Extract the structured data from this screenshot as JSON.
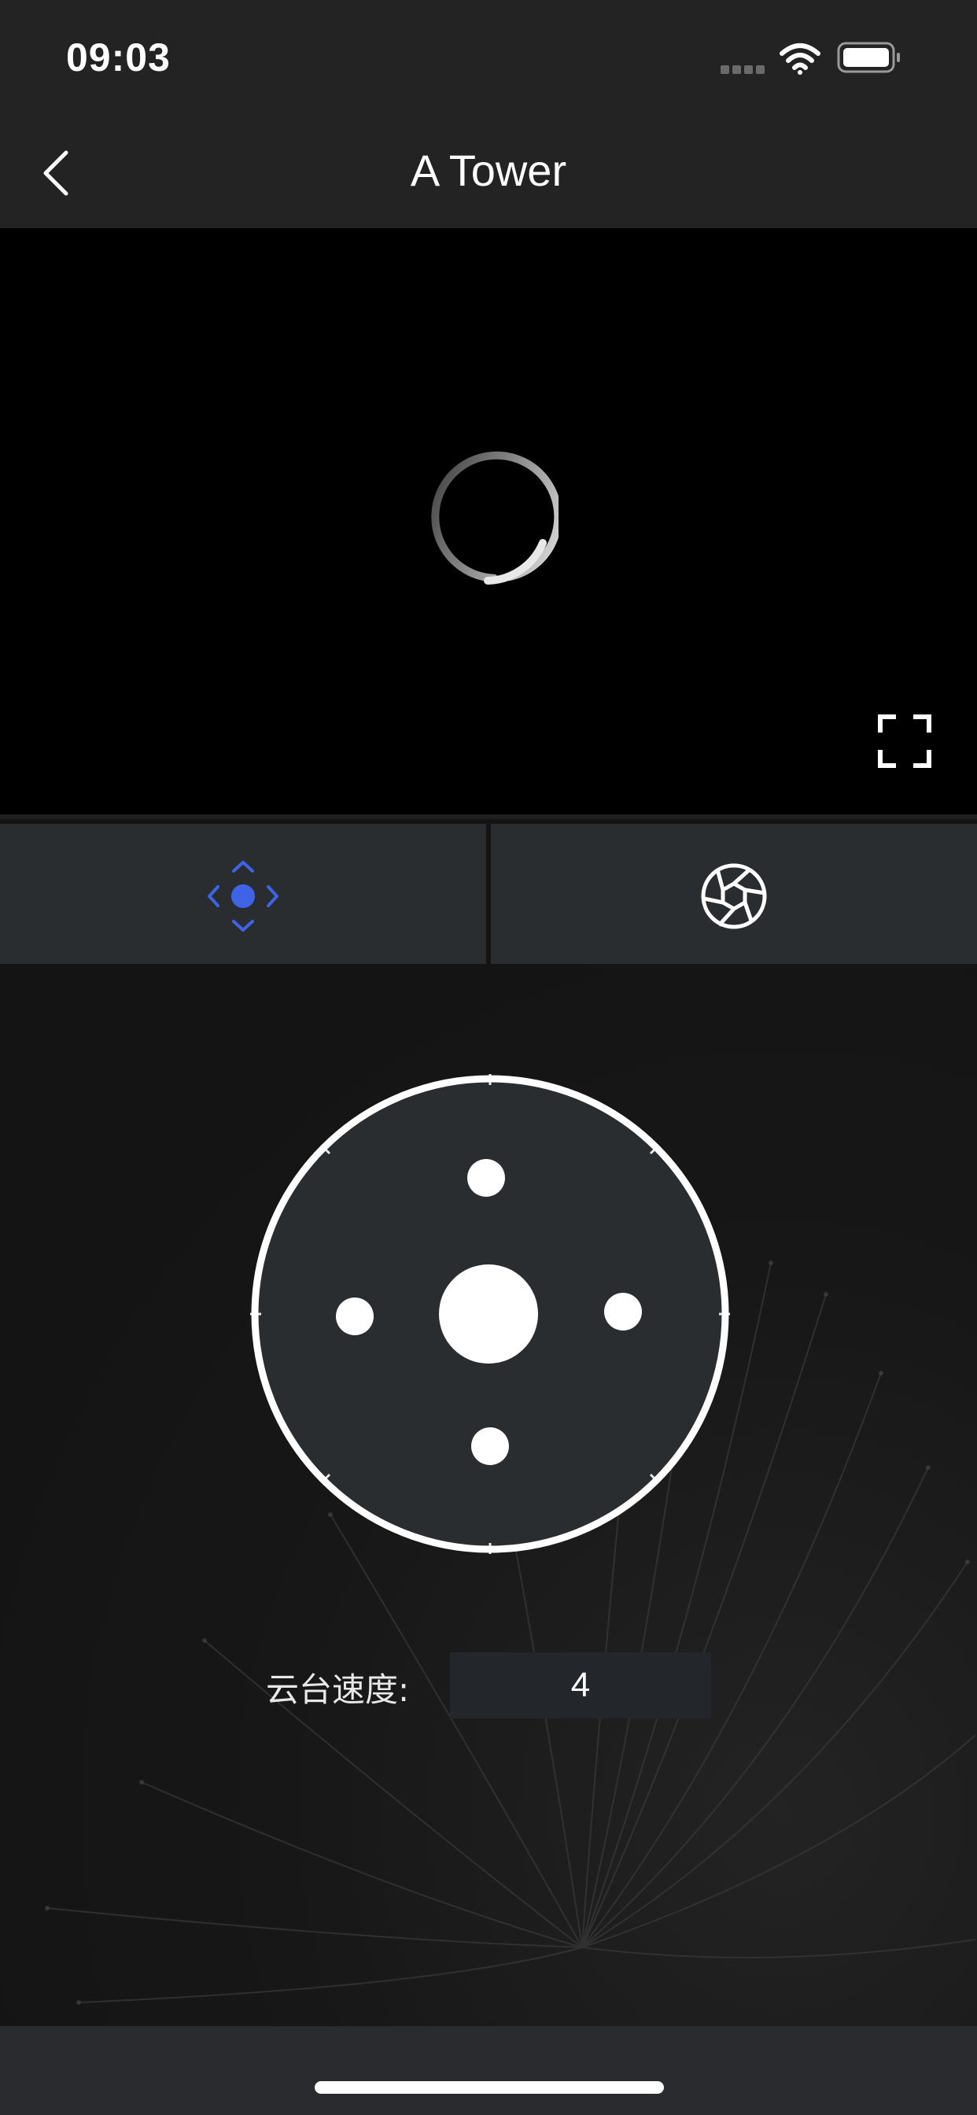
{
  "status_bar": {
    "time": "09:03",
    "icons": [
      "signal-icon",
      "wifi-icon",
      "battery-icon"
    ]
  },
  "nav": {
    "title": "A Tower",
    "back_icon": "chevron-left-icon"
  },
  "video": {
    "state": "loading",
    "fullscreen_icon": "fullscreen-icon"
  },
  "tabs": [
    {
      "name": "ptz-control",
      "icon": "direction-pad-icon",
      "active": true
    },
    {
      "name": "snapshot",
      "icon": "aperture-icon",
      "active": false
    }
  ],
  "ptz": {
    "speed_label": "云台速度:",
    "speed_value": "4"
  },
  "colors": {
    "accent": "#3f63e6",
    "bar_background": "#232324",
    "tab_background": "#2a2d30",
    "joystick_fill": "#2a2d30"
  }
}
